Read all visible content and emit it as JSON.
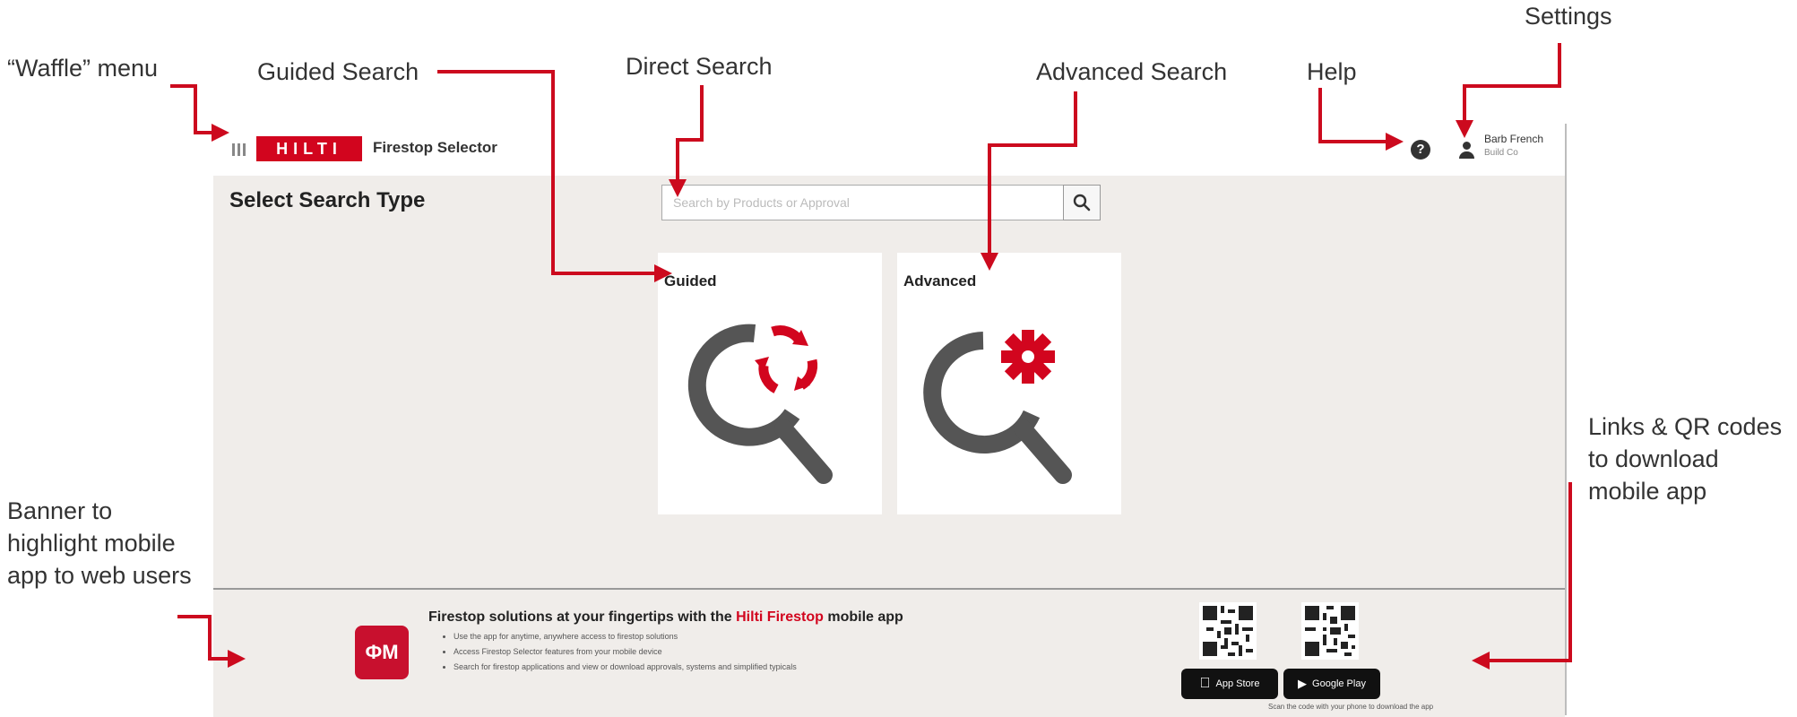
{
  "annotations": {
    "waffle_menu": "“Waffle” menu",
    "guided_search": "Guided Search",
    "direct_search": "Direct Search",
    "advanced_search": "Advanced Search",
    "help": "Help",
    "settings": "Settings",
    "links_qr": "Links & QR codes to download mobile app",
    "banner": "Banner to highlight mobile app to web users"
  },
  "header": {
    "logo_text": "HILTI",
    "app_name": "Firestop Selector",
    "help_symbol": "?",
    "user_name": "Barb French",
    "user_company": "Build Co"
  },
  "main": {
    "page_title": "Select Search Type",
    "search_placeholder": "Search by Products or Approval",
    "cards": [
      {
        "label": "Guided",
        "icon": "guided-search-icon"
      },
      {
        "label": "Advanced",
        "icon": "advanced-search-icon"
      }
    ]
  },
  "banner": {
    "app_icon_text": "ФМ",
    "title_prefix": "Firestop solutions at your fingertips with the ",
    "title_brand": "Hilti Firestop",
    "title_suffix": " mobile app",
    "bullets": [
      "Use the app for anytime, anywhere access to firestop solutions",
      "Access Firestop Selector features from your mobile device",
      "Search for firestop applications and view or download approvals, systems and simplified typicals"
    ],
    "app_store_label": "App Store",
    "google_play_label": "Google Play",
    "scan_note": "Scan the code with your phone to download the app"
  },
  "colors": {
    "brand_red": "#d2051e",
    "annotation_red": "#cc0a1e",
    "icon_gray": "#555555",
    "page_bg": "#f0edea"
  }
}
